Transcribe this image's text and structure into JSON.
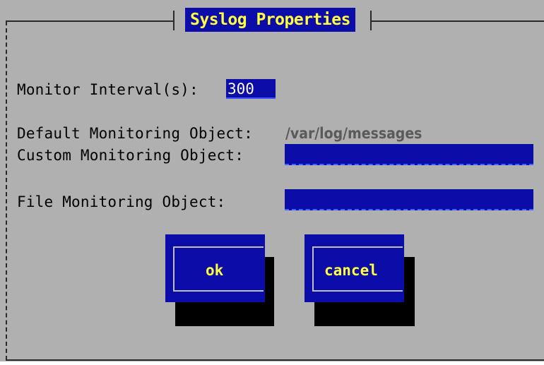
{
  "dialog": {
    "title": "Syslog Properties"
  },
  "fields": {
    "monitor_interval": {
      "label": "Monitor Interval(s):",
      "value": "300"
    },
    "default_monitoring_object": {
      "label": "Default Monitoring Object:",
      "value": "/var/log/messages"
    },
    "custom_monitoring_object": {
      "label": "Custom Monitoring Object:",
      "value": ""
    },
    "file_monitoring_object": {
      "label": "File Monitoring Object:",
      "value": ""
    }
  },
  "buttons": {
    "ok": "ok",
    "cancel": "cancel"
  },
  "colors": {
    "background": "#b0b0b0",
    "field_blue": "#0c0ca8",
    "highlight_yellow": "#ffff40",
    "shadow": "#000000"
  }
}
